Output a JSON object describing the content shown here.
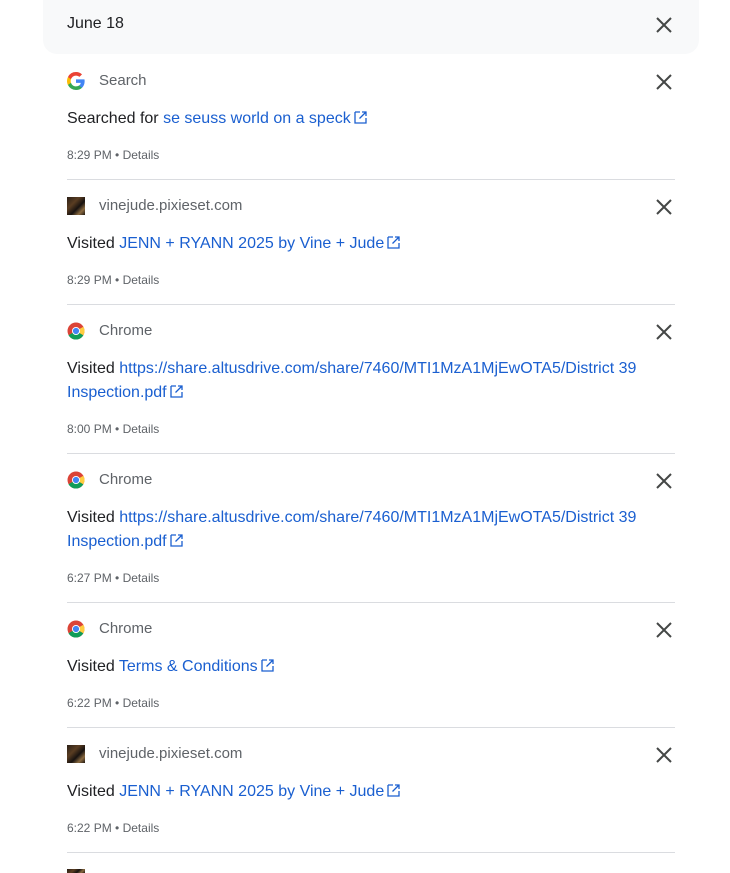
{
  "date_header": {
    "title": "June 18"
  },
  "entries": [
    {
      "source": "Search",
      "icon": "google-icon",
      "verb": "Searched for",
      "link": "se seuss world on a speck",
      "time": "8:29 PM",
      "details": "Details"
    },
    {
      "source": "vinejude.pixieset.com",
      "icon": "site-favicon",
      "verb": "Visited",
      "link": "JENN + RYANN 2025 by Vine + Jude",
      "time": "8:29 PM",
      "details": "Details"
    },
    {
      "source": "Chrome",
      "icon": "chrome-icon",
      "verb": "Visited",
      "link": "https://share.altusdrive.com/share/7460/MTI1MzA1MjEwOTA5/District 39 Inspection.pdf",
      "time": "8:00 PM",
      "details": "Details"
    },
    {
      "source": "Chrome",
      "icon": "chrome-icon",
      "verb": "Visited",
      "link": "https://share.altusdrive.com/share/7460/MTI1MzA1MjEwOTA5/District 39 Inspection.pdf",
      "time": "6:27 PM",
      "details": "Details"
    },
    {
      "source": "Chrome",
      "icon": "chrome-icon",
      "verb": "Visited",
      "link": "Terms & Conditions",
      "time": "6:22 PM",
      "details": "Details"
    },
    {
      "source": "vinejude.pixieset.com",
      "icon": "site-favicon",
      "verb": "Visited",
      "link": "JENN + RYANN 2025 by Vine + Jude",
      "time": "6:22 PM",
      "details": "Details"
    }
  ],
  "separator": "•",
  "colors": {
    "link": "#1a5fd0",
    "muted": "#5f6368",
    "divider": "#dadce0",
    "header_bg": "#f8f9fa"
  }
}
